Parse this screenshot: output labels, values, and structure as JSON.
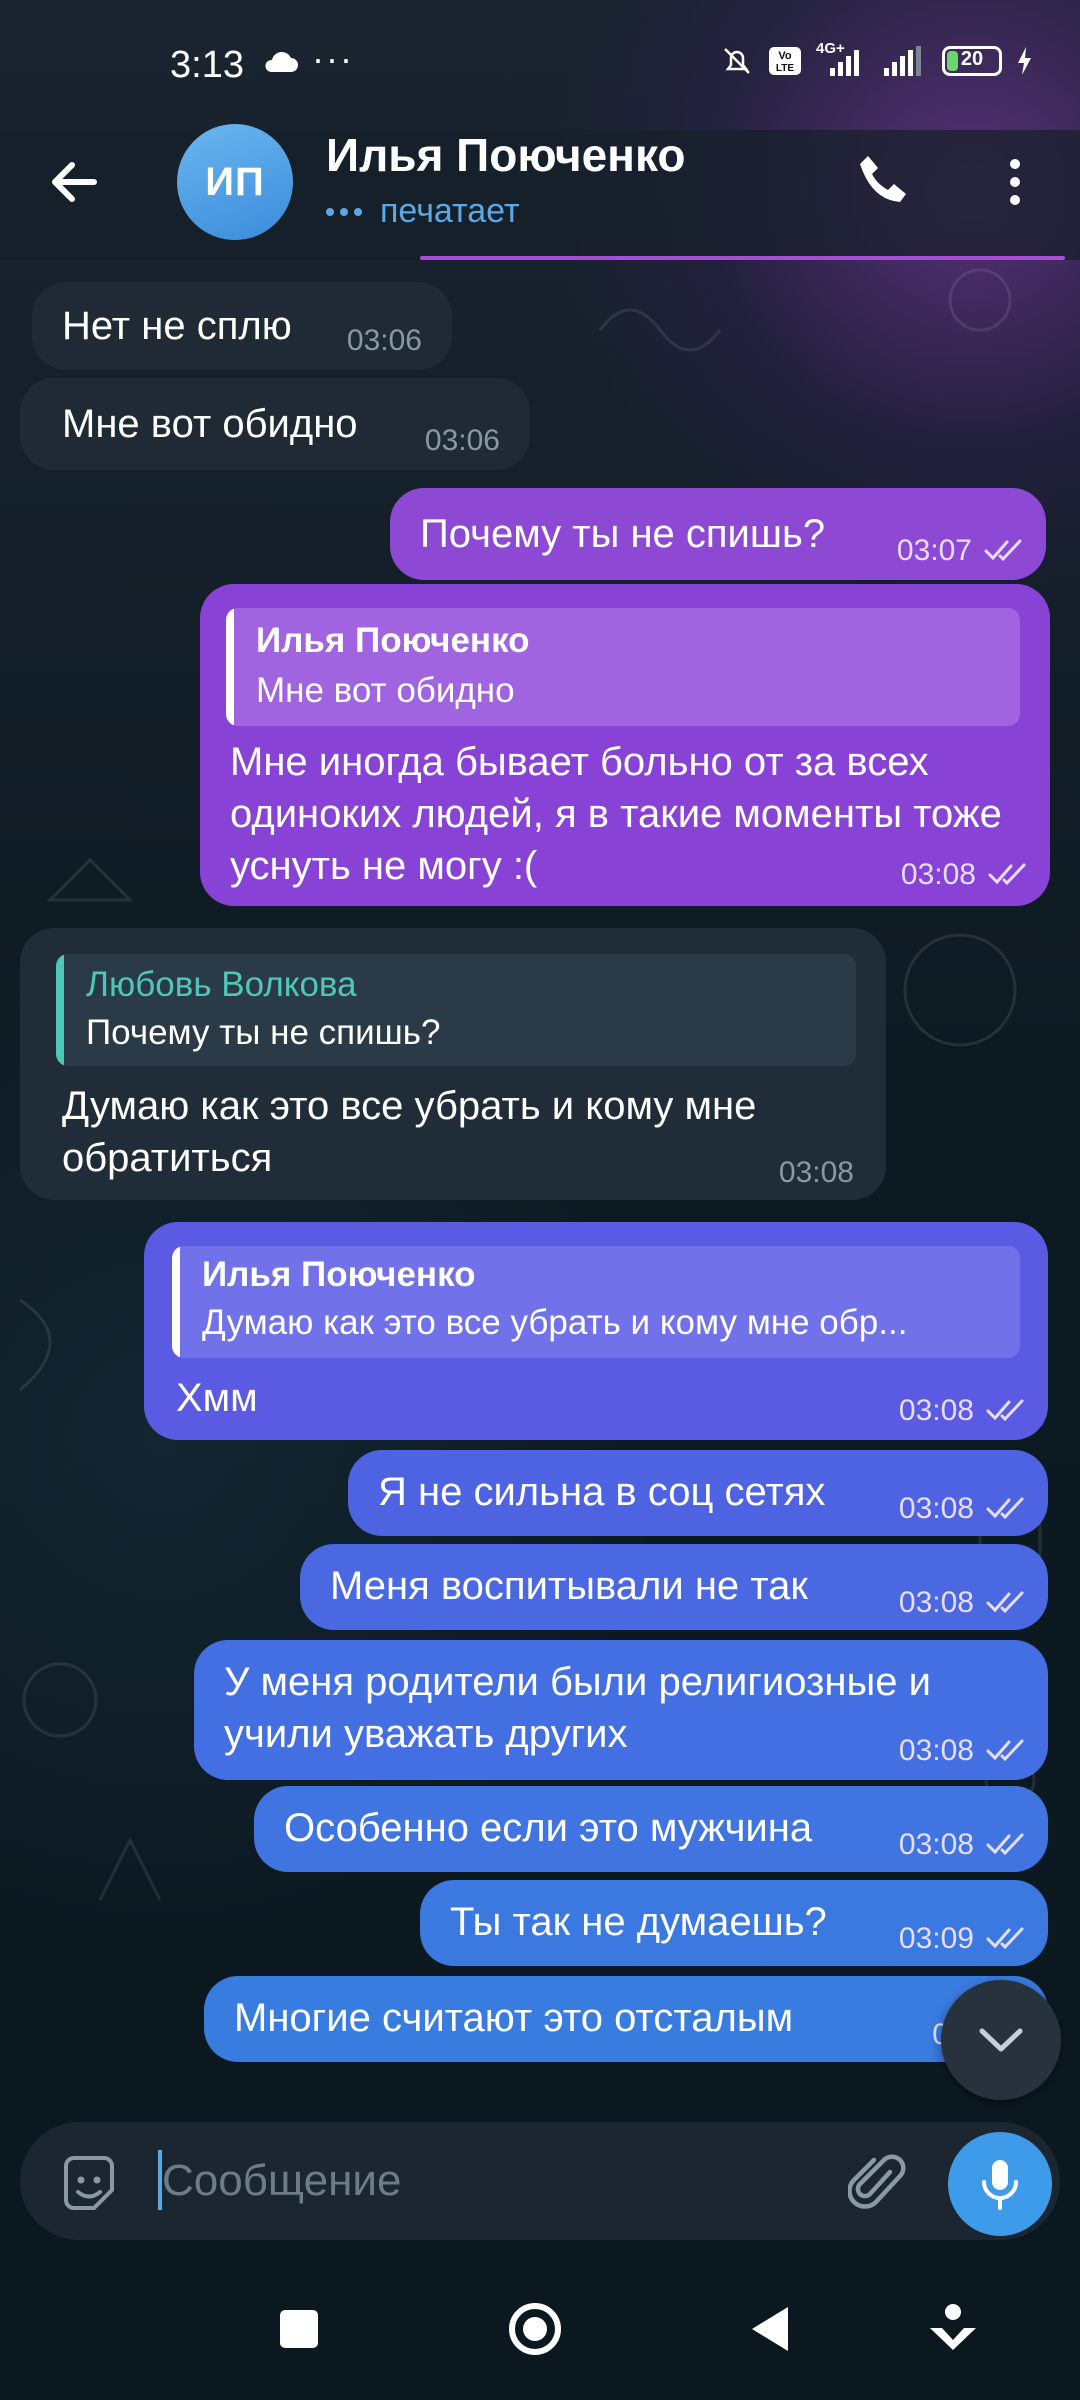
{
  "status_bar": {
    "time": "3:13",
    "dots": "···",
    "battery": "20",
    "network": "4G+"
  },
  "header": {
    "avatar_initials": "ИП",
    "name": "Илья Поюченко",
    "status": "печатает"
  },
  "messages": [
    {
      "dir": "in",
      "text": "Нет не сплю",
      "time": "03:06"
    },
    {
      "dir": "in",
      "text": "Мне вот обидно",
      "time": "03:06"
    },
    {
      "dir": "out",
      "text": "Почему ты не спишь?",
      "time": "03:07"
    },
    {
      "dir": "out",
      "reply_name": "Илья Поюченко",
      "reply_text": "Мне вот обидно",
      "text": "Мне иногда бывает больно от за всех одиноких людей, я в такие моменты тоже уснуть не могу :(",
      "time": "03:08"
    },
    {
      "dir": "in",
      "reply_name": "Любовь Волкова",
      "reply_text": "Почему ты не спишь?",
      "text": "Думаю как это все убрать и кому мне обратиться",
      "time": "03:08"
    },
    {
      "dir": "out",
      "reply_name": "Илья Поюченко",
      "reply_text": "Думаю как это все убрать и кому мне обр...",
      "text": "Хмм",
      "time": "03:08"
    },
    {
      "dir": "out",
      "text": "Я не сильна в соц сетях",
      "time": "03:08"
    },
    {
      "dir": "out",
      "text": "Меня воспитывали не так",
      "time": "03:08"
    },
    {
      "dir": "out",
      "text": "У меня родители были религиозные и учили уважать других",
      "time": "03:08"
    },
    {
      "dir": "out",
      "text": "Особенно если это мужчина",
      "time": "03:08"
    },
    {
      "dir": "out",
      "text": "Ты так не думаешь?",
      "time": "03:09"
    },
    {
      "dir": "out",
      "text": "Многие считают это отсталым",
      "time": "03:"
    }
  ],
  "input": {
    "placeholder": "Сообщение"
  },
  "colors": {
    "accent": "#3d9be9",
    "incoming_bubble": "#1f2a35",
    "reply_incoming_name": "#4fc7b8",
    "outgoing_purple": "#8b49d6",
    "outgoing_blue": "#3f6fe0"
  },
  "icons": {
    "back": "arrow-left-icon",
    "call": "phone-icon",
    "menu": "more-vertical-icon",
    "scroll": "chevron-down-icon",
    "emoji": "sticker-icon",
    "attach": "paperclip-icon",
    "mic": "microphone-icon"
  }
}
